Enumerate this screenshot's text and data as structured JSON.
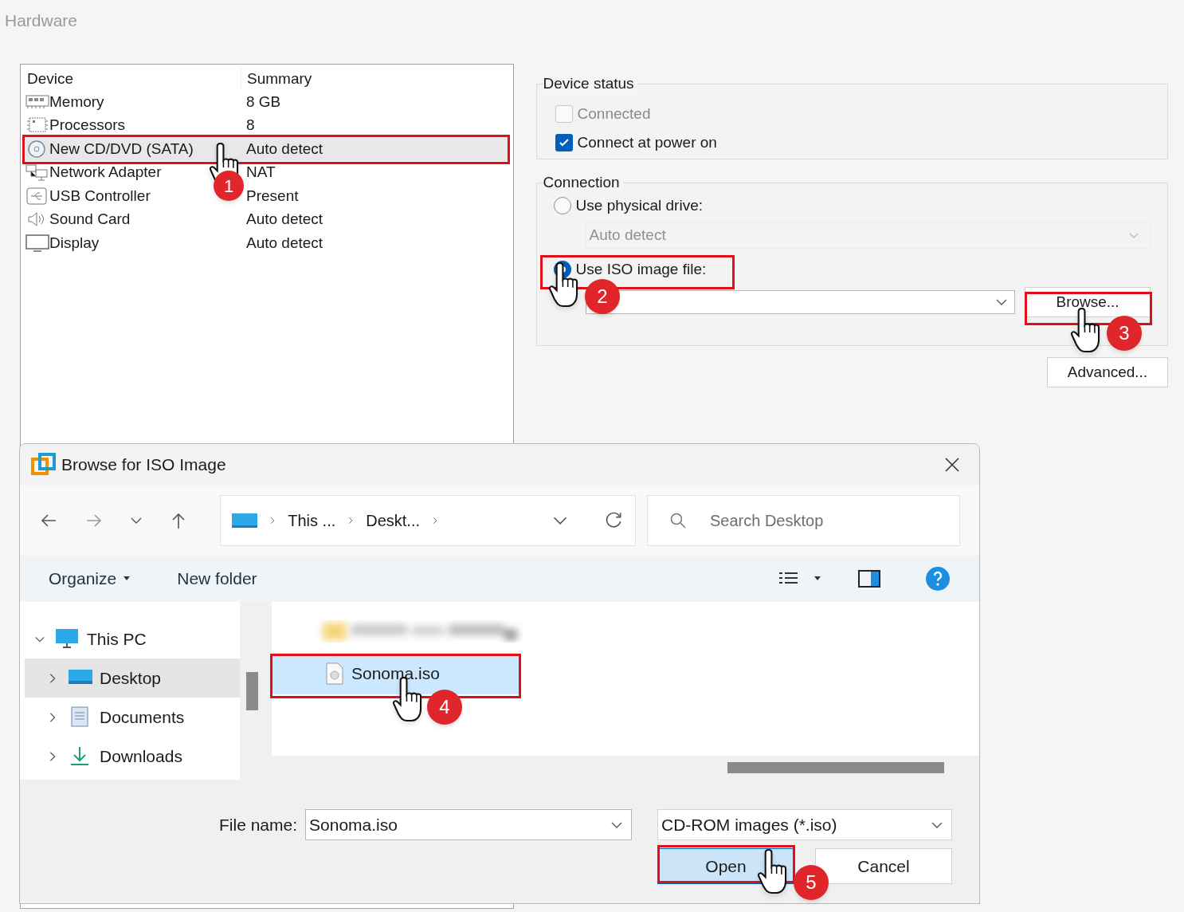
{
  "window": {
    "title": "Hardware"
  },
  "devices": {
    "columns": [
      "Device",
      "Summary"
    ],
    "rows": [
      {
        "kind": "memory",
        "name": "Memory",
        "summary": "8 GB",
        "selected": false
      },
      {
        "kind": "cpu",
        "name": "Processors",
        "summary": "8",
        "selected": false
      },
      {
        "kind": "disc",
        "name": "New CD/DVD (SATA)",
        "summary": "Auto detect",
        "selected": true
      },
      {
        "kind": "network",
        "name": "Network Adapter",
        "summary": "NAT",
        "selected": false
      },
      {
        "kind": "usb",
        "name": "USB Controller",
        "summary": "Present",
        "selected": false
      },
      {
        "kind": "sound",
        "name": "Sound Card",
        "summary": "Auto detect",
        "selected": false
      },
      {
        "kind": "display",
        "name": "Display",
        "summary": "Auto detect",
        "selected": false
      }
    ]
  },
  "device_status": {
    "title": "Device status",
    "options": [
      {
        "label": "Connected",
        "checked": false,
        "disabled": true
      },
      {
        "label": "Connect at power on",
        "checked": true,
        "disabled": false
      }
    ]
  },
  "connection": {
    "title": "Connection",
    "options": [
      {
        "label": "Use physical drive:",
        "selected": false
      },
      {
        "label": "Use ISO image file:",
        "selected": true
      }
    ],
    "drive_select": {
      "value": "Auto detect",
      "disabled": true
    },
    "browse_button": "Browse..."
  },
  "advanced_button": "Advanced...",
  "dialog": {
    "title": "Browse for ISO Image",
    "breadcrumbs": [
      "This ...",
      "Deskt..."
    ],
    "search": {
      "placeholder": "Search Desktop"
    },
    "toolbar": [
      "Organize",
      "New folder"
    ],
    "tree": [
      {
        "kind": "pc",
        "label": "This PC",
        "expanded": true,
        "selected": false,
        "children": [
          {
            "kind": "desktop",
            "label": "Desktop",
            "expanded": false,
            "selected": true
          },
          {
            "kind": "documents",
            "label": "Documents",
            "expanded": false,
            "selected": false
          },
          {
            "kind": "downloads",
            "label": "Downloads",
            "expanded": false,
            "selected": false
          }
        ]
      }
    ],
    "files": [
      {
        "kind": "picture"
      },
      {
        "kind": "file",
        "name": "Sonoma.iso",
        "selected": true
      }
    ],
    "file_name_label": "File name:",
    "file_name": "Sonoma.iso",
    "file_type": "CD-ROM images (*.iso)",
    "buttons": [
      {
        "label": "Open",
        "default": true
      },
      {
        "label": "Cancel",
        "default": false
      }
    ]
  },
  "annotations": [
    {
      "number": "1"
    },
    {
      "number": "2"
    },
    {
      "number": "3"
    },
    {
      "number": "4"
    },
    {
      "number": "5"
    }
  ]
}
